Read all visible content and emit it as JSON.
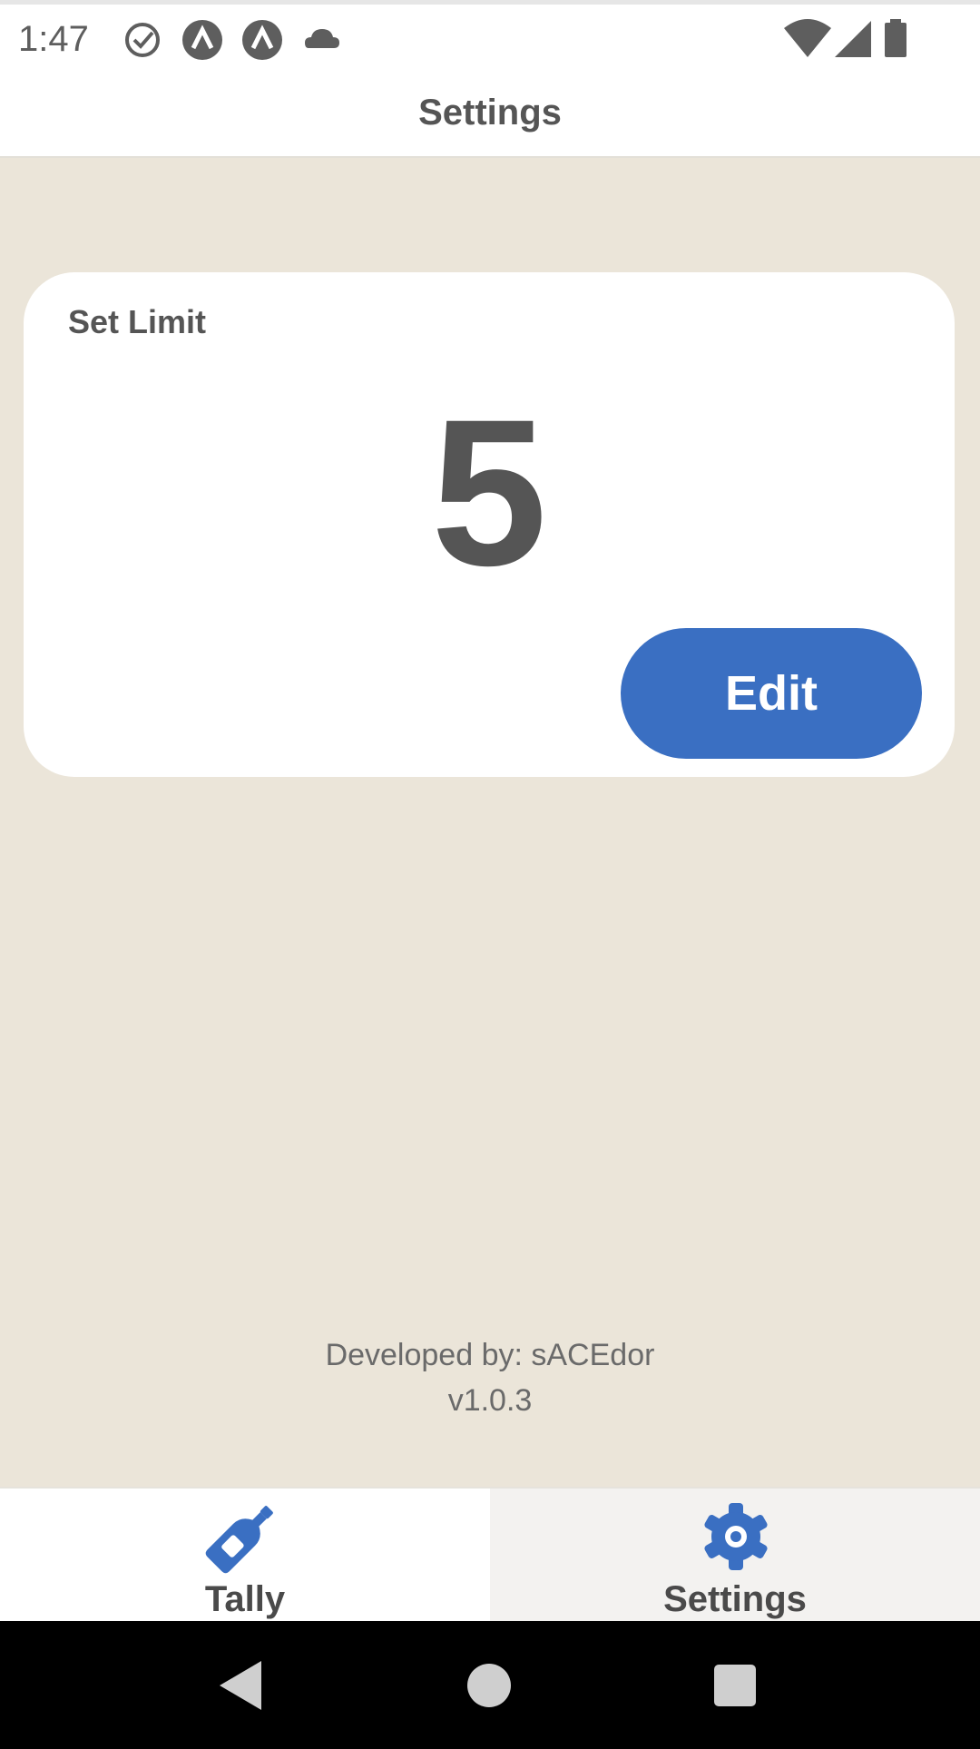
{
  "status_bar": {
    "time": "1:47",
    "icons_left": [
      "check-circle-icon",
      "app-a-icon",
      "app-a-icon",
      "cloud-icon"
    ],
    "icons_right": [
      "wifi-icon",
      "signal-icon",
      "battery-icon"
    ]
  },
  "header": {
    "title": "Settings"
  },
  "limit_card": {
    "label": "Set Limit",
    "value": "5",
    "edit_label": "Edit"
  },
  "footer": {
    "developer": "Developed by: sACEdor",
    "version": "v1.0.3"
  },
  "bottom_nav": {
    "tabs": [
      {
        "label": "Tally",
        "icon": "bottle-icon",
        "active": false
      },
      {
        "label": "Settings",
        "icon": "gear-icon",
        "active": true
      }
    ]
  },
  "colors": {
    "background": "#ebe5d9",
    "accent": "#3a6fc2",
    "card": "#ffffff",
    "text": "#555555"
  }
}
